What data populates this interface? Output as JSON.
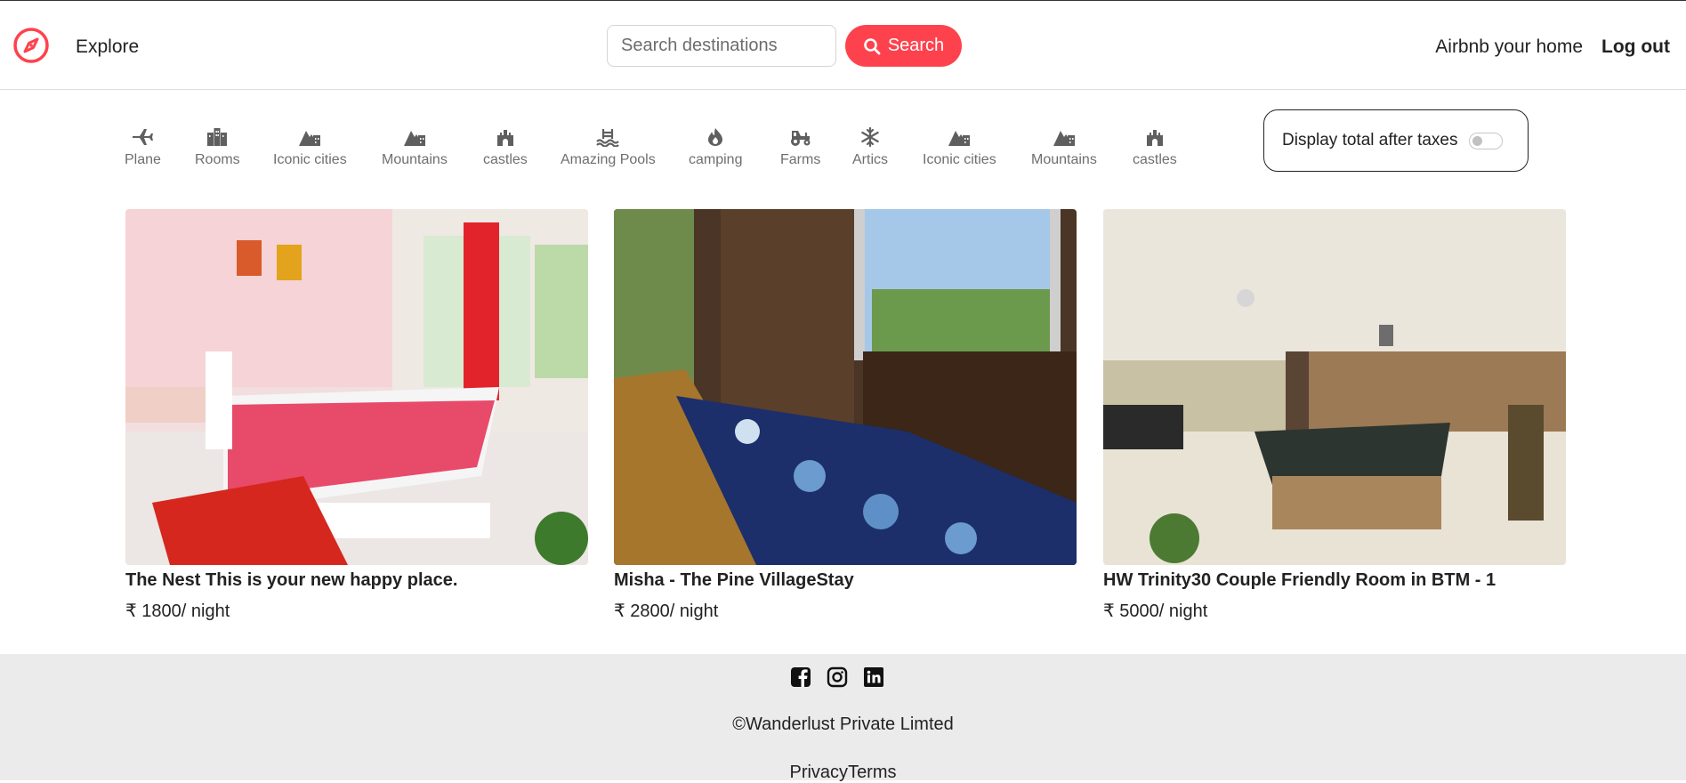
{
  "navbar": {
    "explore_label": "Explore",
    "search_placeholder": "Search destinations",
    "search_button": "Search",
    "host_link": "Airbnb your home",
    "logout_link": "Log out",
    "accent_color": "#fe424d"
  },
  "filters": [
    {
      "label": "Plane",
      "icon": "plane-icon"
    },
    {
      "label": "Rooms",
      "icon": "building-icon"
    },
    {
      "label": "Iconic cities",
      "icon": "mountain-city-icon"
    },
    {
      "label": "Mountains",
      "icon": "mountain-city-icon"
    },
    {
      "label": "castles",
      "icon": "castle-icon"
    },
    {
      "label": "Amazing Pools",
      "icon": "pool-icon"
    },
    {
      "label": "camping",
      "icon": "campfire-icon"
    },
    {
      "label": "Farms",
      "icon": "tractor-icon"
    },
    {
      "label": "Artics",
      "icon": "snowflake-icon"
    },
    {
      "label": "Iconic cities",
      "icon": "mountain-city-icon"
    },
    {
      "label": "Mountains",
      "icon": "mountain-city-icon"
    },
    {
      "label": "castles",
      "icon": "castle-icon"
    }
  ],
  "tax_toggle": {
    "label": "Display total after taxes",
    "enabled": false
  },
  "listings": [
    {
      "title": "The Nest This is your new happy place.",
      "price": "₹ 1800/ night"
    },
    {
      "title": "Misha - The Pine VillageStay",
      "price": "₹ 2800/ night"
    },
    {
      "title": "HW Trinity30 Couple Friendly Room in BTM - 1",
      "price": "₹ 5000/ night"
    }
  ],
  "footer": {
    "social_icons": [
      "facebook-icon",
      "instagram-icon",
      "linkedin-icon"
    ],
    "copyright": "©Wanderlust Private Limted",
    "privacy": "Privacy",
    "terms": "Terms"
  }
}
